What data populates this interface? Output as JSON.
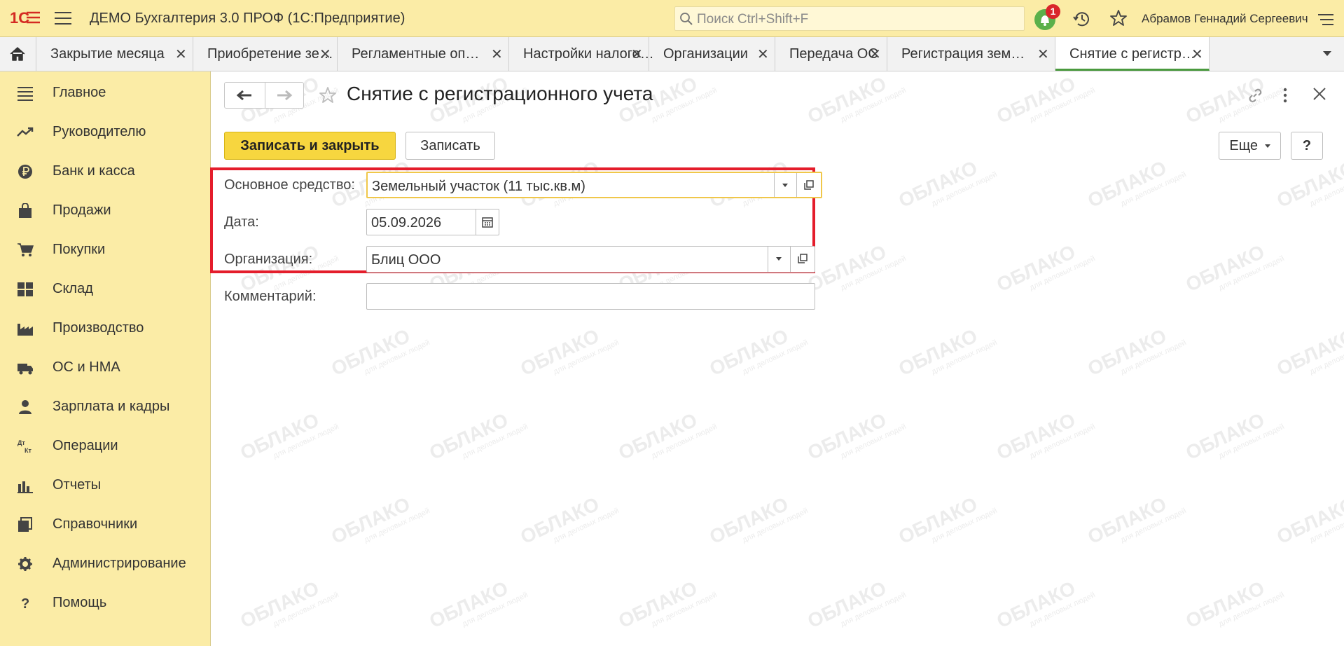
{
  "app": {
    "title": "ДЕМО Бухгалтерия 3.0 ПРОФ  (1С:Предприятие)",
    "logo_text": "1С",
    "search_placeholder": "Поиск Ctrl+Shift+F",
    "notifications_count": "1",
    "user_name": "Абрамов Геннадий Сергеевич"
  },
  "tabs": [
    {
      "label": "Закрытие месяца",
      "active": false
    },
    {
      "label": "Приобретение зе…",
      "active": false
    },
    {
      "label": "Регламентные оп…",
      "active": false
    },
    {
      "label": "Настройки налого…",
      "active": false
    },
    {
      "label": "Организации",
      "active": false
    },
    {
      "label": "Передача ОС",
      "active": false
    },
    {
      "label": "Регистрация зем…",
      "active": false
    },
    {
      "label": "Снятие с регистр…",
      "active": true
    }
  ],
  "tab_close_glyph": "✕",
  "sidebar": {
    "items": [
      {
        "label": "Главное",
        "icon": "menu-icon"
      },
      {
        "label": "Руководителю",
        "icon": "trend-icon"
      },
      {
        "label": "Банк и касса",
        "icon": "ruble-coin-icon"
      },
      {
        "label": "Продажи",
        "icon": "shopping-bag-icon"
      },
      {
        "label": "Покупки",
        "icon": "cart-icon"
      },
      {
        "label": "Склад",
        "icon": "warehouse-icon"
      },
      {
        "label": "Производство",
        "icon": "factory-icon"
      },
      {
        "label": "ОС и НМА",
        "icon": "truck-icon"
      },
      {
        "label": "Зарплата и кадры",
        "icon": "person-icon"
      },
      {
        "label": "Операции",
        "icon": "dt-kt-icon"
      },
      {
        "label": "Отчеты",
        "icon": "bar-chart-icon"
      },
      {
        "label": "Справочники",
        "icon": "books-icon"
      },
      {
        "label": "Администрирование",
        "icon": "gear-icon"
      },
      {
        "label": "Помощь",
        "icon": "question-icon"
      }
    ]
  },
  "form": {
    "title": "Снятие с регистрационного учета",
    "buttons": {
      "save_close": "Записать и закрыть",
      "save": "Записать",
      "more": "Еще",
      "help": "?"
    },
    "fields": {
      "asset_label": "Основное средство:",
      "asset_value": "Земельный участок (11 тыс.кв.м)",
      "date_label": "Дата:",
      "date_value": "05.09.2026",
      "org_label": "Организация:",
      "org_value": "Блиц ООО",
      "comment_label": "Комментарий:",
      "comment_value": ""
    }
  },
  "watermark": {
    "text": "ОБЛАКО",
    "subtext": "для деловых людей"
  },
  "colors": {
    "panel_bg": "#fbeca6",
    "primary_button": "#f7d63f",
    "highlight_frame": "#e41d2b",
    "active_tab_underline": "#4a9a3e",
    "badge": "#d9252b"
  }
}
